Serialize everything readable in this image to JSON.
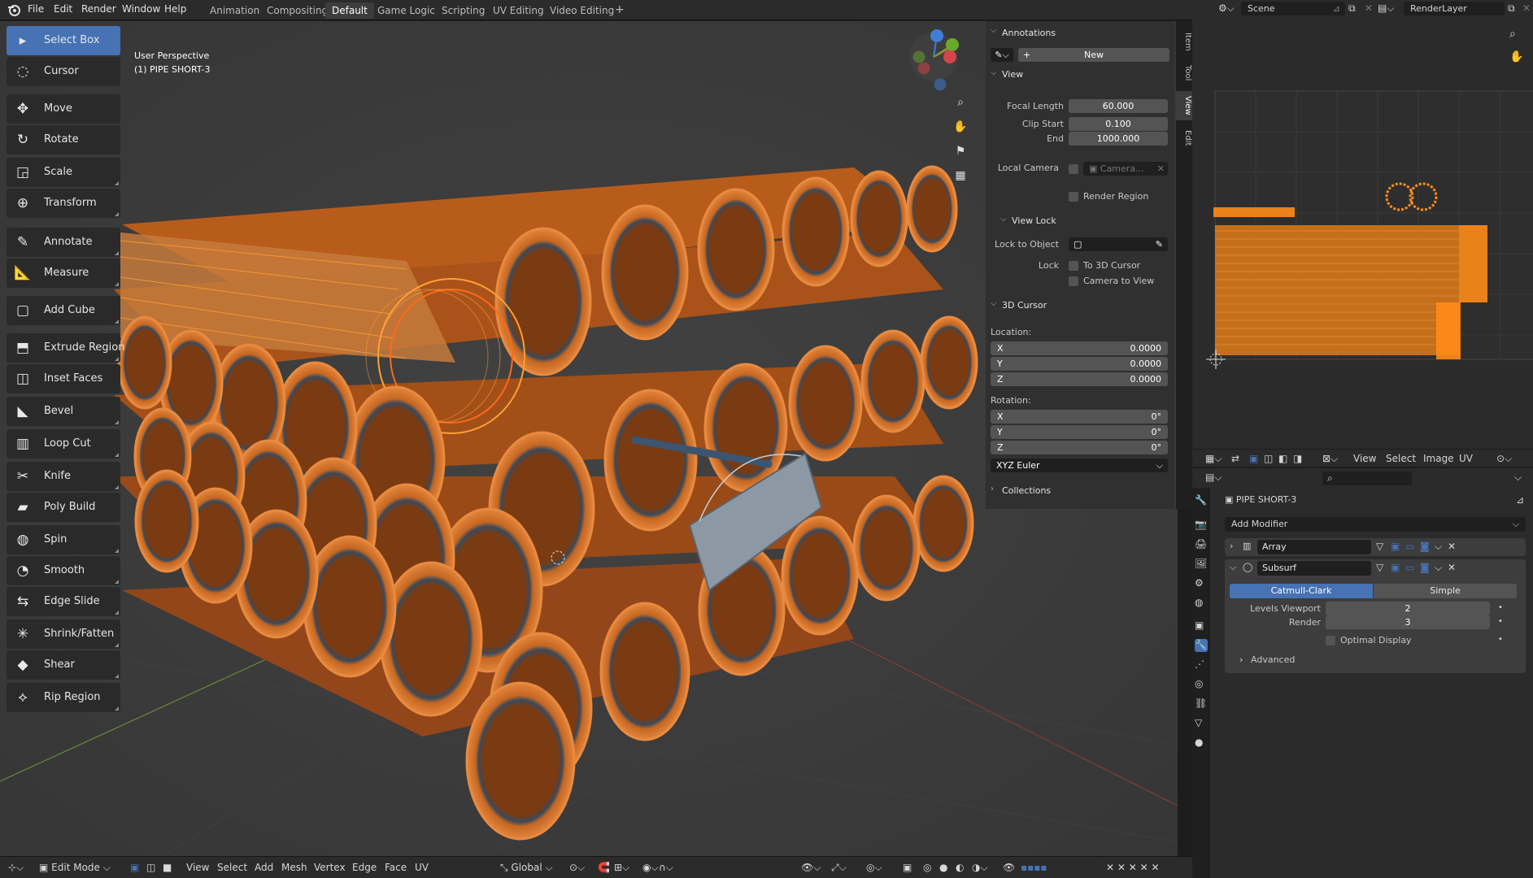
{
  "menubar": {
    "items": [
      "File",
      "Edit",
      "Render",
      "Window",
      "Help"
    ],
    "workspaces": [
      "Animation",
      "Compositing",
      "Default",
      "Game Logic",
      "Scripting",
      "UV Editing",
      "Video Editing"
    ],
    "active_workspace": "Default",
    "add_tab": "+",
    "scene_name": "Scene",
    "render_layer": "RenderLayer"
  },
  "viewport": {
    "perspective": "User Perspective",
    "object_label": "(1) PIPE SHORT-3"
  },
  "toolbar": {
    "tools": [
      {
        "label": "Select Box",
        "icon": "select-box-icon",
        "active": true
      },
      {
        "label": "Cursor",
        "icon": "cursor-icon"
      },
      {
        "label": "Move",
        "icon": "move-icon"
      },
      {
        "label": "Rotate",
        "icon": "rotate-icon"
      },
      {
        "label": "Scale",
        "icon": "scale-icon"
      },
      {
        "label": "Transform",
        "icon": "transform-icon"
      },
      {
        "label": "Annotate",
        "icon": "annotate-icon"
      },
      {
        "label": "Measure",
        "icon": "measure-icon"
      },
      {
        "label": "Add Cube",
        "icon": "add-cube-icon"
      },
      {
        "label": "Extrude Region",
        "icon": "extrude-region-icon"
      },
      {
        "label": "Inset Faces",
        "icon": "inset-faces-icon"
      },
      {
        "label": "Bevel",
        "icon": "bevel-icon"
      },
      {
        "label": "Loop Cut",
        "icon": "loop-cut-icon"
      },
      {
        "label": "Knife",
        "icon": "knife-icon"
      },
      {
        "label": "Poly Build",
        "icon": "poly-build-icon"
      },
      {
        "label": "Spin",
        "icon": "spin-icon"
      },
      {
        "label": "Smooth",
        "icon": "smooth-icon"
      },
      {
        "label": "Edge Slide",
        "icon": "edge-slide-icon"
      },
      {
        "label": "Shrink/Fatten",
        "icon": "shrink-fatten-icon"
      },
      {
        "label": "Shear",
        "icon": "shear-icon"
      },
      {
        "label": "Rip Region",
        "icon": "rip-region-icon"
      }
    ]
  },
  "npanel": {
    "tabs": [
      "Item",
      "Tool",
      "View",
      "Edit"
    ],
    "active_tab": "View",
    "annotations": {
      "title": "Annotations",
      "new_label": "New"
    },
    "view": {
      "title": "View",
      "focal_length_label": "Focal Length",
      "focal_length": "60.000",
      "clip_start_label": "Clip Start",
      "clip_start": "0.100",
      "end_label": "End",
      "end": "1000.000",
      "local_camera_label": "Local Camera",
      "camera_placeholder": "Camera...",
      "render_region_label": "Render Region"
    },
    "view_lock": {
      "title": "View Lock",
      "lock_to_object_label": "Lock to Object",
      "lock_label": "Lock",
      "to_3d_cursor_label": "To 3D Cursor",
      "camera_to_view_label": "Camera to View"
    },
    "cursor3d": {
      "title": "3D Cursor",
      "location_label": "Location:",
      "location": [
        {
          "axis": "X",
          "value": "0.0000"
        },
        {
          "axis": "Y",
          "value": "0.0000"
        },
        {
          "axis": "Z",
          "value": "0.0000"
        }
      ],
      "rotation_label": "Rotation:",
      "rotation": [
        {
          "axis": "X",
          "value": "0°"
        },
        {
          "axis": "Y",
          "value": "0°"
        },
        {
          "axis": "Z",
          "value": "0°"
        }
      ],
      "rotation_mode": "XYZ Euler"
    },
    "collections": {
      "title": "Collections"
    }
  },
  "bottombar": {
    "mode": "Edit Mode",
    "menus": [
      "View",
      "Select",
      "Add",
      "Mesh",
      "Vertex",
      "Edge",
      "Face",
      "UV"
    ],
    "orientation": "Global"
  },
  "uv_editor": {
    "menus": [
      "View",
      "Select",
      "Image",
      "UV"
    ]
  },
  "properties": {
    "object_name": "PIPE SHORT-3",
    "add_modifier_label": "Add Modifier",
    "modifiers": [
      {
        "name": "Array",
        "expanded": false
      },
      {
        "name": "Subsurf",
        "expanded": true
      }
    ],
    "subsurf": {
      "types": [
        "Catmull-Clark",
        "Simple"
      ],
      "active_type": "Catmull-Clark",
      "levels_viewport_label": "Levels Viewport",
      "levels_viewport": "2",
      "render_label": "Render",
      "render": "3",
      "optimal_display_label": "Optimal Display",
      "advanced_label": "Advanced"
    }
  },
  "colors": {
    "accent": "#4772b3",
    "pipe_orange": "#c9661f",
    "selection_orange": "#ffa033",
    "uv_orange": "#ff8c1a"
  }
}
